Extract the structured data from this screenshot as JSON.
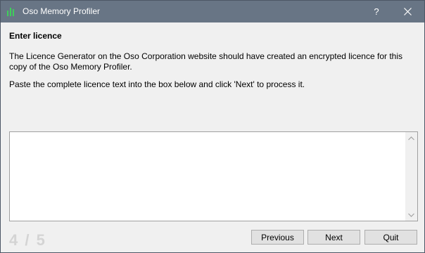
{
  "window": {
    "title": "Oso Memory Profiler",
    "help_glyph": "?"
  },
  "page": {
    "heading": "Enter licence",
    "paragraph1": "The Licence Generator on the Oso Corporation website should have created an encrypted licence for this copy of the Oso Memory Profiler.",
    "paragraph2": "Paste the complete licence text into the box below and click 'Next' to process it.",
    "licence_text": ""
  },
  "wizard": {
    "step_indicator": "4 / 5",
    "buttons": {
      "previous": "Previous",
      "next": "Next",
      "quit": "Quit"
    }
  },
  "icons": {
    "app": "bar-chart-icon",
    "help": "question-mark-icon",
    "close": "close-icon"
  },
  "colors": {
    "titlebar": "#687585",
    "app_icon": "#3fcf5a"
  }
}
